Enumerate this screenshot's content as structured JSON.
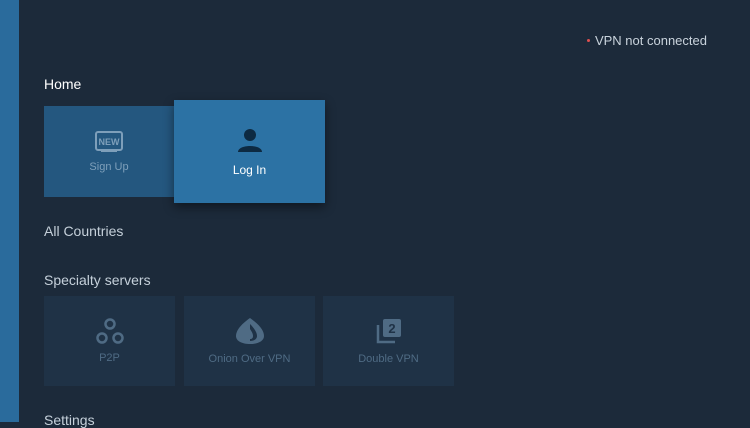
{
  "status": {
    "vpn_text": "VPN not connected",
    "dot_color": "#e05050"
  },
  "home": {
    "title": "Home",
    "tiles": [
      {
        "label": "Sign Up",
        "icon": "new-badge-icon",
        "badge_text": "NEW"
      },
      {
        "label": "Log In",
        "icon": "user-icon"
      }
    ]
  },
  "countries": {
    "title": "All Countries"
  },
  "specialty": {
    "title": "Specialty servers",
    "tiles": [
      {
        "label": "P2P",
        "icon": "p2p-icon"
      },
      {
        "label": "Onion Over VPN",
        "icon": "onion-icon"
      },
      {
        "label": "Double VPN",
        "icon": "double-vpn-icon"
      }
    ]
  },
  "settings": {
    "title": "Settings"
  },
  "colors": {
    "background": "#1c2a3a",
    "accent": "#2c72a4",
    "rail": "#2a6b9c"
  }
}
